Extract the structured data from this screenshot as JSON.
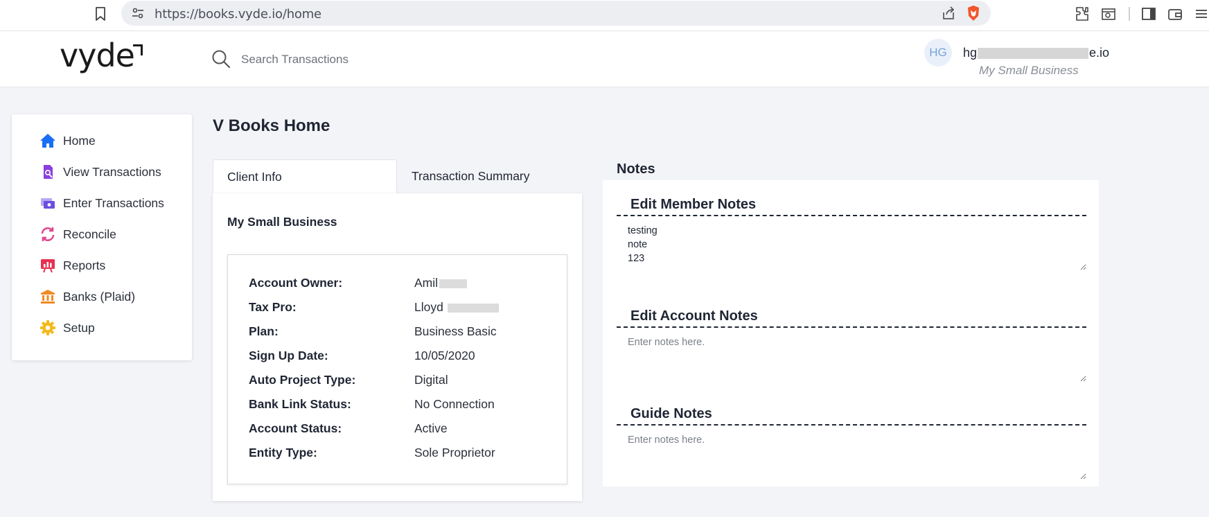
{
  "browser": {
    "url": "https://books.vyde.io/home"
  },
  "header": {
    "logo": "vyde",
    "search_placeholder": "Search Transactions",
    "avatar_initials": "HG",
    "user_email_start": "hg",
    "user_email_end": "e.io",
    "user_business": "My Small Business"
  },
  "sidebar": {
    "items": [
      {
        "label": "Home",
        "icon": "home-icon",
        "color": "#1a6ef5"
      },
      {
        "label": "View Transactions",
        "icon": "view-transactions-icon",
        "color": "#8a3ee0"
      },
      {
        "label": "Enter Transactions",
        "icon": "enter-transactions-icon",
        "color": "#6b4fe0"
      },
      {
        "label": "Reconcile",
        "icon": "reconcile-icon",
        "color": "#e0478f"
      },
      {
        "label": "Reports",
        "icon": "reports-icon",
        "color": "#e8304f"
      },
      {
        "label": "Banks (Plaid)",
        "icon": "bank-icon",
        "color": "#f08a24"
      },
      {
        "label": "Setup",
        "icon": "gear-icon",
        "color": "#f3b81a"
      }
    ]
  },
  "main": {
    "title": "V Books Home",
    "tabs": [
      {
        "label": "Client Info",
        "active": true
      },
      {
        "label": "Transaction Summary",
        "active": false
      }
    ],
    "business_name": "My Small Business",
    "client_info": [
      {
        "label": "Account Owner:",
        "value": "Amil"
      },
      {
        "label": "Tax Pro:",
        "value": "Lloyd"
      },
      {
        "label": "Plan:",
        "value": "Business Basic"
      },
      {
        "label": "Sign Up Date:",
        "value": "10/05/2020"
      },
      {
        "label": "Auto Project Type:",
        "value": "Digital"
      },
      {
        "label": "Bank Link Status:",
        "value": "No Connection"
      },
      {
        "label": "Account Status:",
        "value": "Active"
      },
      {
        "label": "Entity Type:",
        "value": "Sole Proprietor"
      }
    ]
  },
  "notes": {
    "heading": "Notes",
    "member_title": "Edit Member Notes",
    "member_value": "testing\nnote\n123",
    "account_title": "Edit Account Notes",
    "account_placeholder": "Enter notes here.",
    "guide_title": "Guide Notes",
    "guide_placeholder": "Enter notes here."
  }
}
